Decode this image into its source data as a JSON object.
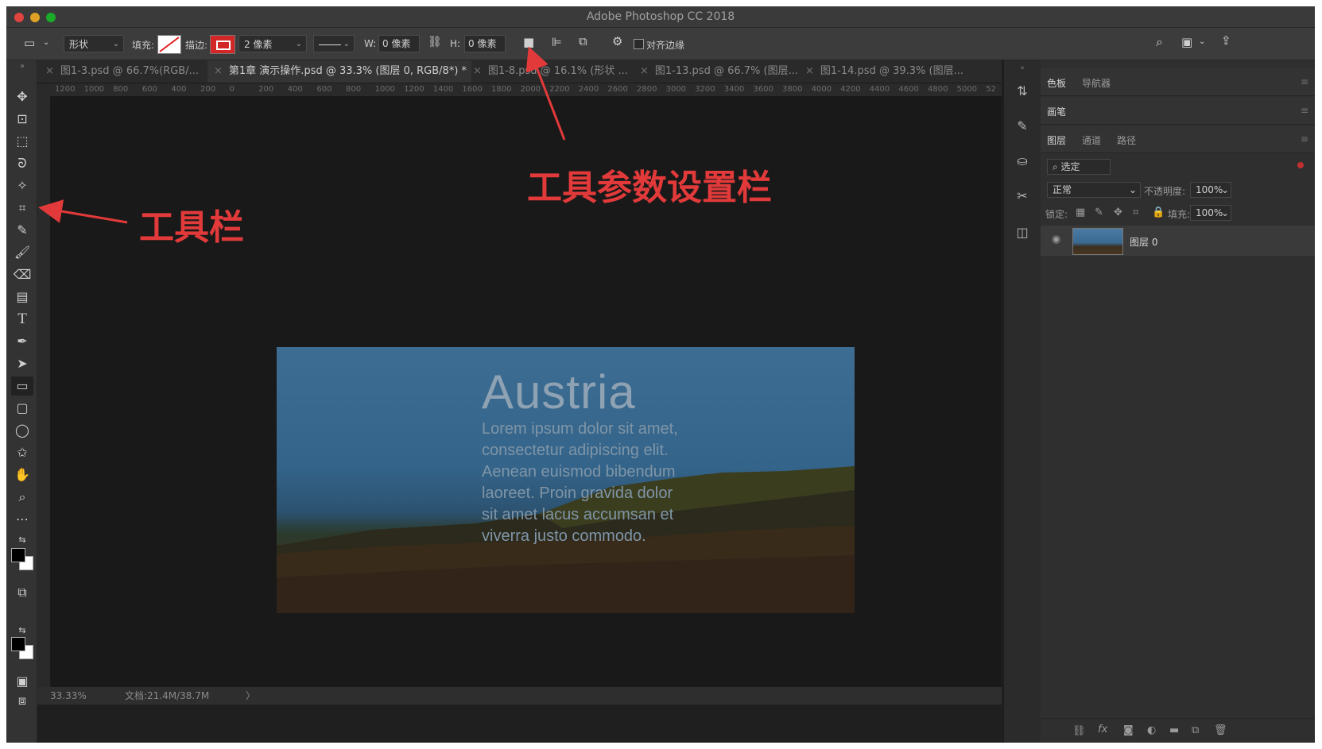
{
  "window": {
    "title": "Adobe Photoshop CC 2018"
  },
  "options_bar": {
    "mode": "形状",
    "fill_label": "填充:",
    "stroke_label": "描边:",
    "stroke_width": "2 像素",
    "w_label": "W:",
    "w_value": "0 像素",
    "h_label": "H:",
    "h_value": "0 像素",
    "align_edges": "对齐边缘"
  },
  "tabs": [
    {
      "label": "图1-3.psd @ 66.7%(RGB/..."
    },
    {
      "label": "第1章 演示操作.psd @ 33.3% (图层 0, RGB/8*) *"
    },
    {
      "label": "图1-8.psd @ 16.1% (形状 ..."
    },
    {
      "label": "图1-13.psd @ 66.7% (图层..."
    },
    {
      "label": "图1-14.psd @ 39.3% (图层..."
    }
  ],
  "ruler_labels": [
    "1200",
    "1000",
    "800",
    "600",
    "400",
    "200",
    "0",
    "200",
    "400",
    "600",
    "800",
    "1000",
    "1200",
    "1400",
    "1600",
    "1800",
    "2000",
    "2200",
    "2400",
    "2600",
    "2800",
    "3000",
    "3200",
    "3400",
    "3600",
    "3800",
    "4000",
    "4200",
    "4400",
    "4600",
    "4800",
    "5000",
    "52"
  ],
  "canvas_image": {
    "title": "Austria",
    "body": "Lorem ipsum dolor sit amet, consectetur adipiscing elit. Aenean euismod bibendum laoreet. Proin gravida dolor sit amet lacus accumsan et viverra justo commodo."
  },
  "status": {
    "zoom": "33.33%",
    "doc": "文档:21.4M/38.7M",
    "arrow": "〉"
  },
  "panels": {
    "row1": [
      "色板",
      "导航器"
    ],
    "row2": [
      "画笔"
    ],
    "row3": [
      "图层",
      "通道",
      "路径"
    ],
    "filter": "选定",
    "blend": "正常",
    "opacity_label": "不透明度:",
    "opacity_value": "100%",
    "lock_label": "锁定:",
    "fill_label": "填充:",
    "fill_value": "100%",
    "layer_name": "图层 0"
  },
  "annotations": {
    "toolbar": "工具栏",
    "options": "工具参数设置栏",
    "color": "#e23a3a"
  }
}
